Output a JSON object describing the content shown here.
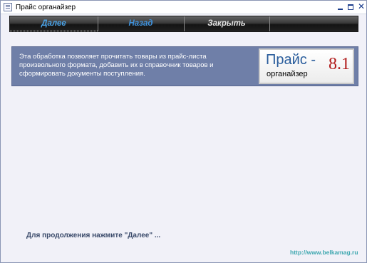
{
  "window": {
    "title": "Прайс органайзер",
    "icon": "app-window-icon"
  },
  "toolbar": {
    "next_label": "Далее",
    "back_label": "Назад",
    "close_label": "Закрыть"
  },
  "info": {
    "text": "Эта обработка позволяет прочитать товары из прайс-листа произвольного формата, добавить их в справочник товаров и сформировать документы поступления."
  },
  "logo": {
    "word1": "Прайс -",
    "word2": "органайзер",
    "version": "8.1"
  },
  "footer": {
    "prompt": "Для продолжения нажмите \"Далее\" ...",
    "link": "http://www.belkamag.ru"
  },
  "colors": {
    "panel_bg": "#6f7fa8",
    "window_bg": "#f1f1f8",
    "accent_blue": "#4aa3e8",
    "logo_version_red": "#b01818",
    "link_teal": "#3fa8b0"
  }
}
